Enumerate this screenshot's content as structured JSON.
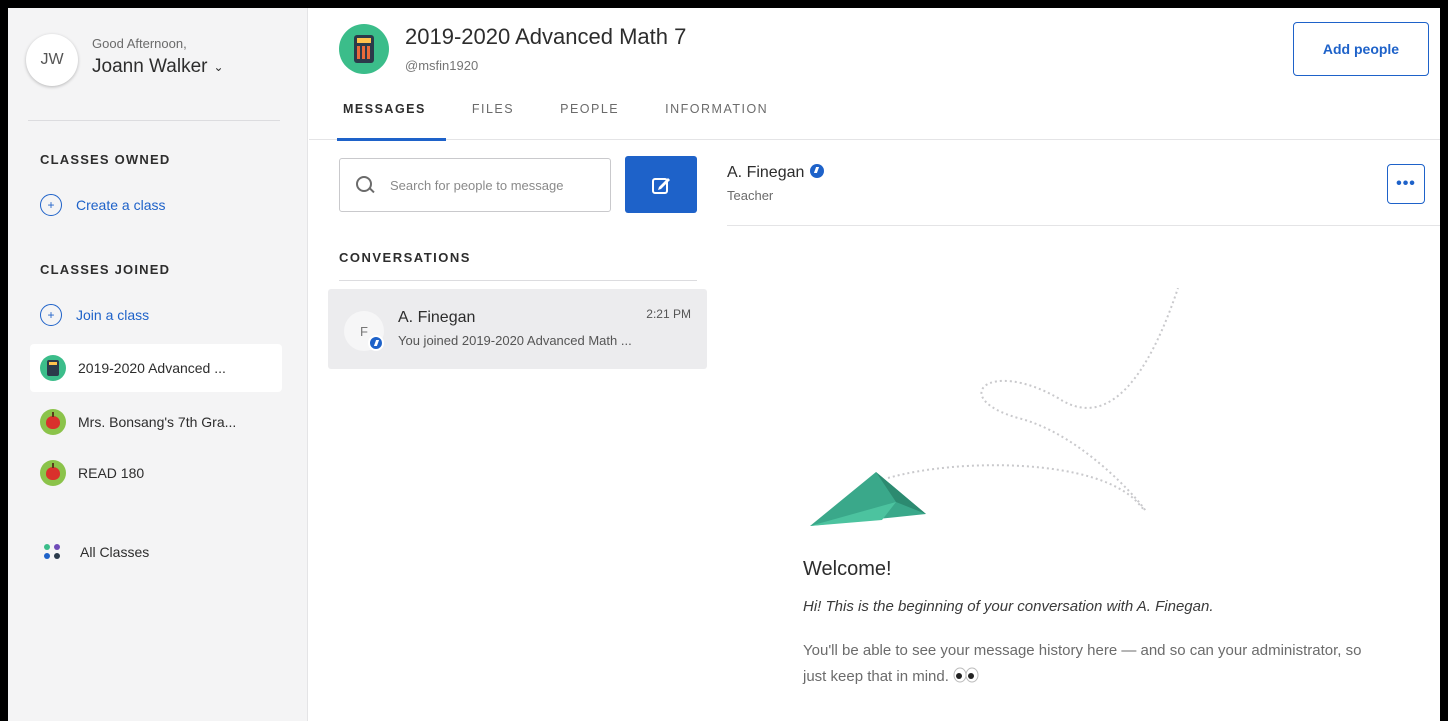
{
  "user": {
    "initials": "JW",
    "greeting": "Good Afternoon,",
    "name": "Joann Walker"
  },
  "sidebar": {
    "owned_title": "CLASSES OWNED",
    "create_label": "Create a class",
    "joined_title": "CLASSES JOINED",
    "join_label": "Join a class",
    "classes": [
      {
        "label": "2019-2020 Advanced ...",
        "icon": "calculator-icon",
        "active": true
      },
      {
        "label": "Mrs. Bonsang's 7th Gra...",
        "icon": "apple-icon",
        "active": false
      },
      {
        "label": "READ 180",
        "icon": "apple-icon",
        "active": false
      }
    ],
    "all_classes_label": "All Classes"
  },
  "header": {
    "class_title": "2019-2020 Advanced Math 7",
    "class_handle": "@msfin1920",
    "add_people_label": "Add people",
    "tabs": [
      {
        "label": "MESSAGES",
        "active": true
      },
      {
        "label": "FILES",
        "active": false
      },
      {
        "label": "PEOPLE",
        "active": false
      },
      {
        "label": "INFORMATION",
        "active": false
      }
    ]
  },
  "conversations": {
    "search_placeholder": "Search for people to message",
    "title": "CONVERSATIONS",
    "items": [
      {
        "initial": "F",
        "name": "A. Finegan",
        "time": "2:21 PM",
        "preview": "You joined 2019-2020 Advanced Math ..."
      }
    ]
  },
  "chat": {
    "name": "A. Finegan",
    "role": "Teacher",
    "more_label": "•••",
    "welcome_title": "Welcome!",
    "welcome_sub": "Hi! This is the beginning of your conversation with A. Finegan.",
    "welcome_body": "You'll be able to see your message history here — and so can your administrator, so just keep that in mind."
  },
  "colors": {
    "accent": "#1e62c9",
    "plane": "#3aa88a",
    "class_green": "#3bbd8a"
  }
}
